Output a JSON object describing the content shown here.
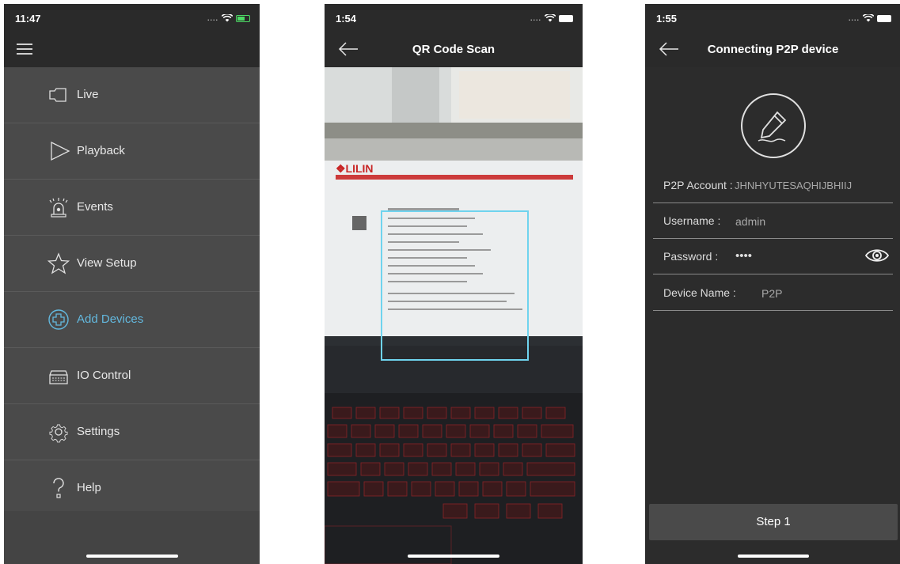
{
  "screens": [
    {
      "status_time": "11:47",
      "menu": [
        {
          "label": "Live",
          "icon": "camera-icon"
        },
        {
          "label": "Playback",
          "icon": "play-icon"
        },
        {
          "label": "Events",
          "icon": "alarm-icon"
        },
        {
          "label": "View Setup",
          "icon": "star-icon"
        },
        {
          "label": "Add Devices",
          "icon": "add-circle-icon",
          "active": true
        },
        {
          "label": "IO Control",
          "icon": "io-control-icon"
        },
        {
          "label": "Settings",
          "icon": "gear-icon"
        },
        {
          "label": "Help",
          "icon": "help-icon"
        }
      ]
    },
    {
      "status_time": "1:54",
      "title": "QR Code Scan"
    },
    {
      "status_time": "1:55",
      "title": "Connecting P2P device",
      "fields": {
        "p2p_account_label": "P2P Account :",
        "p2p_account_value": "JHNHYUTESAQHIJBHIIJ",
        "username_label": "Username :",
        "username_value": "admin",
        "password_label": "Password :",
        "password_value": "••••",
        "device_name_label": "Device Name :",
        "device_name_value": "P2P"
      },
      "step_button": "Step 1"
    }
  ],
  "colors": {
    "menu_bg": "#4a4a4a",
    "active": "#63b8de",
    "scan_frame": "#6fd3ee",
    "form_bg": "#2c2c2c"
  }
}
